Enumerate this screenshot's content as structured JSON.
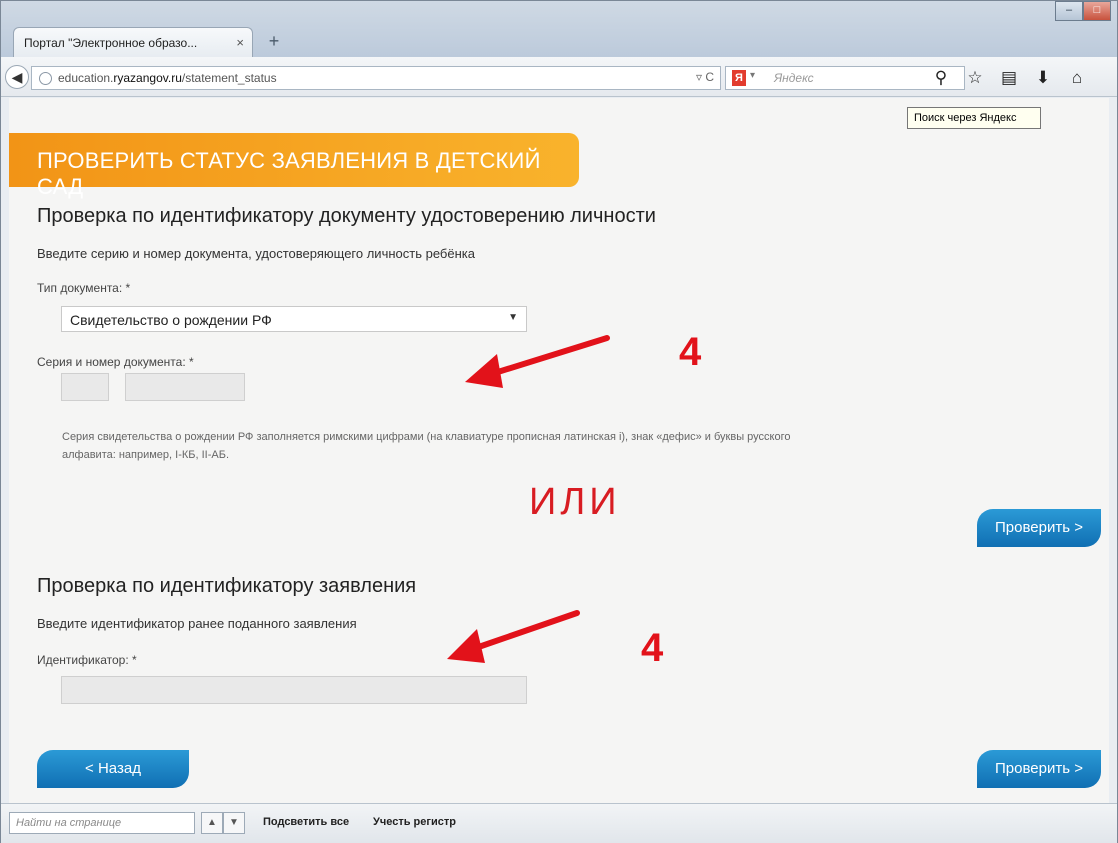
{
  "browser": {
    "tab_title": "Портал \"Электронное образо...",
    "tab_close": "×",
    "new_tab": "+",
    "window_controls": [
      "–",
      "□"
    ],
    "back_icon": "◀",
    "url_prefix": "education.",
    "url_domain": "ryazangov.ru",
    "url_path": "/statement_status",
    "url_tools": "▿ C",
    "search_engine_icon": "Я",
    "search_engine_drop": "▾",
    "search_placeholder": "Яндекс",
    "nav_icons": [
      "search-icon",
      "star-icon",
      "bookmarks-icon",
      "download-icon",
      "home-icon"
    ],
    "nav_glyphs": [
      "⚲",
      "☆",
      "▤",
      "⬇",
      "⌂"
    ],
    "tooltip": "Поиск через Яндекс"
  },
  "page": {
    "banner": "ПРОВЕРИТЬ СТАТУС ЗАЯВЛЕНИЯ В ДЕТСКИЙ САД",
    "section1": {
      "title": "Проверка по идентификатору документу удостоверению личности",
      "hint": "Введите серию и номер документа, удостоверяющего личность ребёнка",
      "doc_type_label": "Тип документа: *",
      "doc_type_value": "Свидетельство о рождении РФ",
      "series_label": "Серия и номер документа: *",
      "note": "Серия свидетельства о рождении РФ заполняется римскими цифрами (на клавиатуре прописная латинская i), знак «дефис» и буквы русского алфавита: например, I-КБ, II-АБ.",
      "check_button": "Проверить >"
    },
    "or_text": "ИЛИ",
    "section2": {
      "title": "Проверка по идентификатору заявления",
      "hint": "Введите идентификатор ранее поданного заявления",
      "id_label": "Идентификатор: *",
      "id_value": ""
    },
    "back_button": "< Назад",
    "check_button_bottom": "Проверить >",
    "annotation_number": "4"
  },
  "findbar": {
    "placeholder": "Найти на странице",
    "up": "▲",
    "down": "▼",
    "highlight_all": "Подсветить все",
    "match_case": "Учесть регистр"
  },
  "colors": {
    "banner_orange": "#f29416",
    "button_blue": "#1781c4",
    "annotation_red": "#e2121a"
  }
}
